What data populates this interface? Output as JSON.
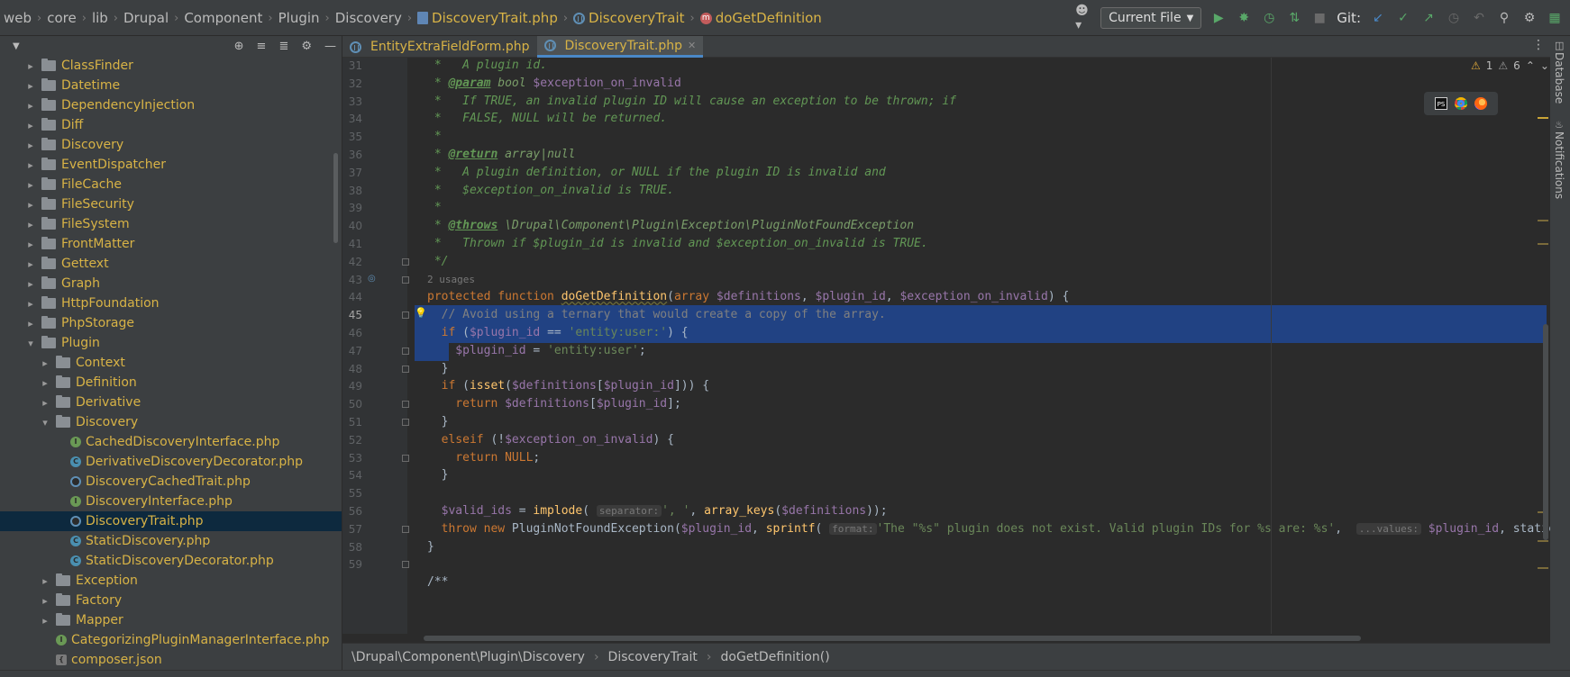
{
  "breadcrumbs": [
    {
      "label": "web",
      "yellow": false
    },
    {
      "label": "core",
      "yellow": false
    },
    {
      "label": "lib",
      "yellow": false
    },
    {
      "label": "Drupal",
      "yellow": false
    },
    {
      "label": "Component",
      "yellow": false
    },
    {
      "label": "Plugin",
      "yellow": false
    },
    {
      "label": "Discovery",
      "yellow": false
    },
    {
      "label": "DiscoveryTrait.php",
      "yellow": true
    },
    {
      "label": "DiscoveryTrait",
      "yellow": true
    },
    {
      "label": "doGetDefinition",
      "yellow": true
    }
  ],
  "toolbar": {
    "run_config": "Current File",
    "git_label": "Git:"
  },
  "tabs": [
    {
      "label": "EntityExtraFieldForm.php",
      "active": false
    },
    {
      "label": "DiscoveryTrait.php",
      "active": true
    }
  ],
  "tree": [
    {
      "label": "ClassFinder",
      "kind": "folder",
      "depth": 1,
      "open": false,
      "color": "yellow"
    },
    {
      "label": "Datetime",
      "kind": "folder",
      "depth": 1,
      "open": false,
      "color": "yellow"
    },
    {
      "label": "DependencyInjection",
      "kind": "folder",
      "depth": 1,
      "open": false,
      "color": "yellow"
    },
    {
      "label": "Diff",
      "kind": "folder",
      "depth": 1,
      "open": false,
      "color": "yellow"
    },
    {
      "label": "Discovery",
      "kind": "folder",
      "depth": 1,
      "open": false,
      "color": "yellow"
    },
    {
      "label": "EventDispatcher",
      "kind": "folder",
      "depth": 1,
      "open": false,
      "color": "yellow"
    },
    {
      "label": "FileCache",
      "kind": "folder",
      "depth": 1,
      "open": false,
      "color": "yellow"
    },
    {
      "label": "FileSecurity",
      "kind": "folder",
      "depth": 1,
      "open": false,
      "color": "yellow"
    },
    {
      "label": "FileSystem",
      "kind": "folder",
      "depth": 1,
      "open": false,
      "color": "yellow"
    },
    {
      "label": "FrontMatter",
      "kind": "folder",
      "depth": 1,
      "open": false,
      "color": "yellow"
    },
    {
      "label": "Gettext",
      "kind": "folder",
      "depth": 1,
      "open": false,
      "color": "yellow"
    },
    {
      "label": "Graph",
      "kind": "folder",
      "depth": 1,
      "open": false,
      "color": "yellow"
    },
    {
      "label": "HttpFoundation",
      "kind": "folder",
      "depth": 1,
      "open": false,
      "color": "yellow"
    },
    {
      "label": "PhpStorage",
      "kind": "folder",
      "depth": 1,
      "open": false,
      "color": "yellow"
    },
    {
      "label": "Plugin",
      "kind": "folder",
      "depth": 1,
      "open": true,
      "color": "yellow"
    },
    {
      "label": "Context",
      "kind": "folder",
      "depth": 2,
      "open": false,
      "color": "yellow"
    },
    {
      "label": "Definition",
      "kind": "folder",
      "depth": 2,
      "open": false,
      "color": "yellow"
    },
    {
      "label": "Derivative",
      "kind": "folder",
      "depth": 2,
      "open": false,
      "color": "yellow"
    },
    {
      "label": "Discovery",
      "kind": "folder",
      "depth": 2,
      "open": true,
      "color": "yellow"
    },
    {
      "label": "CachedDiscoveryInterface.php",
      "kind": "interface",
      "depth": 3,
      "color": "yellow"
    },
    {
      "label": "DerivativeDiscoveryDecorator.php",
      "kind": "class",
      "depth": 3,
      "color": "yellow"
    },
    {
      "label": "DiscoveryCachedTrait.php",
      "kind": "trait",
      "depth": 3,
      "color": "yellow"
    },
    {
      "label": "DiscoveryInterface.php",
      "kind": "interface",
      "depth": 3,
      "color": "yellow"
    },
    {
      "label": "DiscoveryTrait.php",
      "kind": "trait",
      "depth": 3,
      "color": "yellow",
      "selected": true
    },
    {
      "label": "StaticDiscovery.php",
      "kind": "class",
      "depth": 3,
      "color": "yellow"
    },
    {
      "label": "StaticDiscoveryDecorator.php",
      "kind": "class",
      "depth": 3,
      "color": "yellow"
    },
    {
      "label": "Exception",
      "kind": "folder",
      "depth": 2,
      "open": false,
      "color": "yellow"
    },
    {
      "label": "Factory",
      "kind": "folder",
      "depth": 2,
      "open": false,
      "color": "yellow"
    },
    {
      "label": "Mapper",
      "kind": "folder",
      "depth": 2,
      "open": false,
      "color": "yellow"
    },
    {
      "label": "CategorizingPluginManagerInterface.php",
      "kind": "interface",
      "depth": 2,
      "color": "yellow"
    },
    {
      "label": "composer.json",
      "kind": "json",
      "depth": 2,
      "color": "yellow"
    }
  ],
  "editor": {
    "line_numbers": [
      "31",
      "32",
      "33",
      "34",
      "35",
      "36",
      "37",
      "38",
      "39",
      "40",
      "41",
      "42",
      "43",
      "44",
      "45",
      "46",
      "47",
      "48",
      "49",
      "50",
      "51",
      "52",
      "53",
      "54",
      "55",
      "56",
      "57",
      "58",
      "59"
    ],
    "current_line": "45",
    "usages_label": "2 usages",
    "problems": {
      "warnings": "1",
      "weak_warnings": "6"
    },
    "code": {
      "l31": {
        "a": " *   A plugin id."
      },
      "l32": {
        "star": " * ",
        "tag": "@param",
        "type": " bool ",
        "rest": "$exception_on_invalid"
      },
      "l33": {
        "a": " *   If TRUE, an invalid plugin ID will cause an exception to be thrown; if"
      },
      "l34": {
        "a": " *   FALSE, NULL will be returned."
      },
      "l35": {
        "a": " *"
      },
      "l36": {
        "star": " * ",
        "tag": "@return",
        "type": " array|null"
      },
      "l37": {
        "a": " *   A plugin definition, or NULL if the plugin ID is invalid and"
      },
      "l38": {
        "a": " *   $exception_on_invalid is TRUE."
      },
      "l39": {
        "a": " *"
      },
      "l40": {
        "star": " * ",
        "tag": "@throws",
        "type": " \\Drupal\\Component\\Plugin\\Exception\\PluginNotFoundException"
      },
      "l41": {
        "a": " *   Thrown if $plugin_id is invalid and $exception_on_invalid is TRUE."
      },
      "l42": {
        "a": " */"
      },
      "l43": {
        "k1": "protected function ",
        "fn": "doGetDefinition",
        "p1": "(",
        "k2": "array ",
        "v1": "$definitions",
        "p2": ", ",
        "v2": "$plugin_id",
        "p3": ", ",
        "v3": "$exception_on_invalid",
        "p4": ") {"
      },
      "l44": {
        "a": "  // Avoid using a ternary that would create a copy of the array."
      },
      "l45": {
        "k": "  if ",
        "p1": "(",
        "v": "$plugin_id",
        "p2": " == ",
        "s": "'entity:user:'",
        "p3": ") {"
      },
      "l46": {
        "v": "    $plugin_id",
        "p1": " = ",
        "s": "'entity:user'",
        "p2": ";"
      },
      "l47": {
        "a": "  }"
      },
      "l48": {
        "k": "  if ",
        "p1": "(",
        "fn": "isset",
        "p2": "(",
        "v1": "$definitions",
        "p3": "[",
        "v2": "$plugin_id",
        "p4": "])) {"
      },
      "l49": {
        "k": "    return ",
        "v1": "$definitions",
        "p1": "[",
        "v2": "$plugin_id",
        "p2": "];"
      },
      "l50": {
        "a": "  }"
      },
      "l51": {
        "k": "  elseif ",
        "p1": "(!",
        "v": "$exception_on_invalid",
        "p2": ") {"
      },
      "l52": {
        "k": "    return ",
        "k2": "NULL",
        "p": ";"
      },
      "l53": {
        "a": "  }"
      },
      "l54": {
        "a": ""
      },
      "l55": {
        "v1": "  $valid_ids",
        "p1": " = ",
        "fn": "implode",
        "p2": "( ",
        "hint": "separator:",
        "s": "', '",
        "p3": ", ",
        "fn2": "array_keys",
        "p4": "(",
        "v2": "$definitions",
        "p5": "));"
      },
      "l56": {
        "k": "  throw new ",
        "cls": "PluginNotFoundException",
        "p1": "(",
        "v1": "$plugin_id",
        "p2": ", ",
        "fn": "sprintf",
        "p3": "( ",
        "hint": "format:",
        "s": "'The \"%s\" plugin does not exist. Valid plugin IDs for %s are: %s'",
        "p4": ",  ",
        "hint2": "...values:",
        "v2": " $plugin_id",
        "p5": ", static"
      },
      "l57": {
        "a": "}"
      },
      "l58": {
        "a": ""
      },
      "l59": {
        "a": "/**"
      }
    }
  },
  "bottom_breadcrumbs": [
    "\\Drupal\\Component\\Plugin\\Discovery",
    "DiscoveryTrait",
    "doGetDefinition()"
  ],
  "right_strip": {
    "database": "Database",
    "notifications": "Notifications"
  },
  "colors": {
    "selection": "#214283",
    "accent_tab": "#4a88c7",
    "folder_text": "#d8b346"
  }
}
